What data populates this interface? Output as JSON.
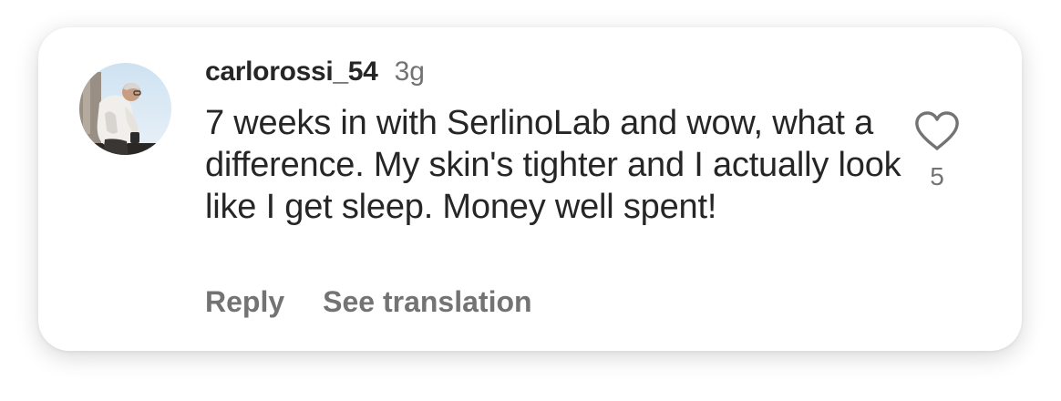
{
  "comment": {
    "username": "carlorossi_54",
    "timestamp": "3g",
    "text": "7 weeks in with SerlinoLab and wow, what a difference. My skin's tighter and I actually look like I get sleep. Money well spent!",
    "like_count": "5",
    "avatar_icon": "avatar-photo"
  },
  "actions": {
    "reply_label": "Reply",
    "translate_label": "See translation"
  },
  "icons": {
    "like": "heart-outline-icon"
  },
  "colors": {
    "text_primary": "#262626",
    "text_secondary": "#737373",
    "card_background": "#ffffff"
  }
}
